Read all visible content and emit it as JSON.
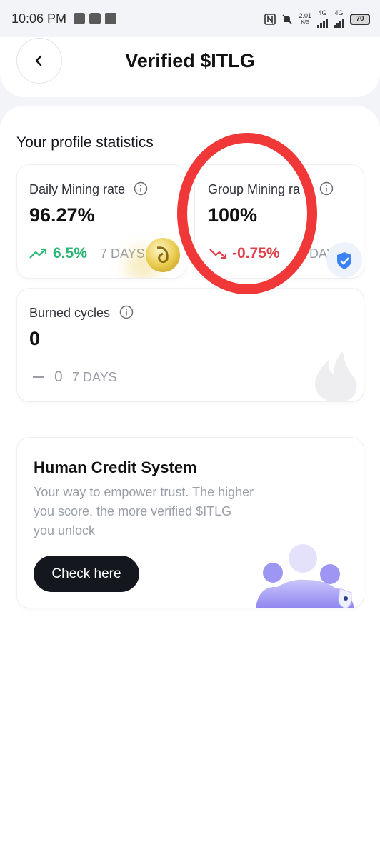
{
  "status_bar": {
    "time": "10:06 PM",
    "net_speed": "2.01",
    "net_unit": "K/S",
    "net1": "4G",
    "net2": "4G",
    "battery": "70"
  },
  "header": {
    "title": "Verified $ITLG",
    "back_icon": "chevron-left-icon"
  },
  "stats": {
    "section_title": "Your profile statistics",
    "daily": {
      "label": "Daily Mining rate",
      "value": "96.27%",
      "change": "6.5%",
      "period": "7 DAYS",
      "trend": "up",
      "color": "#2bb673"
    },
    "group": {
      "label": "Group Mining ra",
      "value": "100%",
      "change": "-0.75%",
      "period": "7 DAYS",
      "trend": "down",
      "color": "#e0404a"
    },
    "burned": {
      "label": "Burned cycles",
      "value": "0",
      "change": "0",
      "period": "7 DAYS",
      "trend": "flat",
      "color": "#9a9da6"
    }
  },
  "human_credit": {
    "title": "Human Credit System",
    "description": "Your way to empower trust. The higher you score, the more verified $ITLG you unlock",
    "button_label": "Check here"
  },
  "colors": {
    "annotation_red": "#f03838",
    "button_dark": "#15171e",
    "background_grey": "#f3f4f8"
  }
}
